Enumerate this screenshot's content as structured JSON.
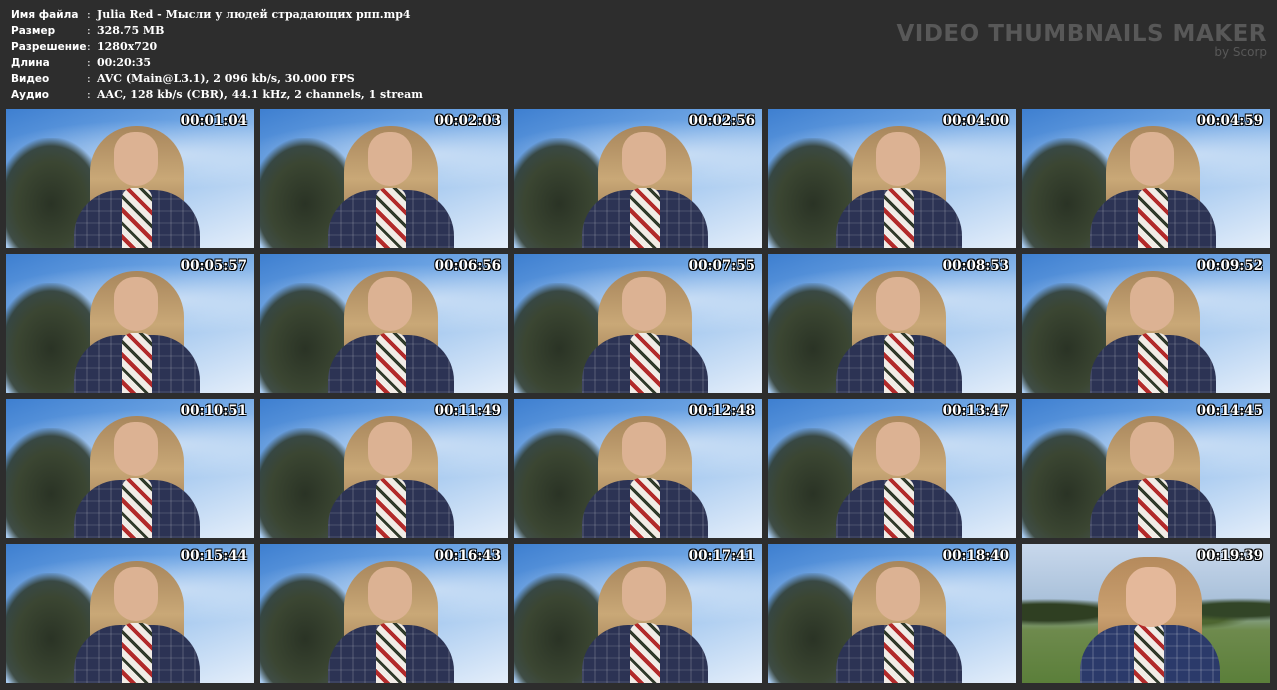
{
  "file_info": [
    {
      "label": "Имя файла",
      "sep": ":",
      "value": "Julia Red - Мысли у людей страдающих рпп.mp4"
    },
    {
      "label": "Размер",
      "sep": ":",
      "value": "328.75 MB"
    },
    {
      "label": "Разрешение",
      "sep": ":",
      "value": "1280x720"
    },
    {
      "label": "Длина",
      "sep": ":",
      "value": "00:20:35"
    },
    {
      "label": "Видео",
      "sep": ":",
      "value": "AVC (Main@L3.1), 2 096 kb/s, 30.000 FPS"
    },
    {
      "label": "Аудио",
      "sep": ":",
      "value": "AAC, 128 kb/s (CBR), 44.1 kHz, 2 channels, 1 stream"
    }
  ],
  "branding": {
    "title": "VIDEO THUMBNAILS MAKER",
    "subtitle": "by Scorp"
  },
  "thumbnails": [
    {
      "timestamp": "00:01:04"
    },
    {
      "timestamp": "00:02:03"
    },
    {
      "timestamp": "00:02:56"
    },
    {
      "timestamp": "00:04:00"
    },
    {
      "timestamp": "00:04:59"
    },
    {
      "timestamp": "00:05:57"
    },
    {
      "timestamp": "00:06:56"
    },
    {
      "timestamp": "00:07:55"
    },
    {
      "timestamp": "00:08:53"
    },
    {
      "timestamp": "00:09:52"
    },
    {
      "timestamp": "00:10:51"
    },
    {
      "timestamp": "00:11:49"
    },
    {
      "timestamp": "00:12:48"
    },
    {
      "timestamp": "00:13:47"
    },
    {
      "timestamp": "00:14:45"
    },
    {
      "timestamp": "00:15:44"
    },
    {
      "timestamp": "00:16:43"
    },
    {
      "timestamp": "00:17:41"
    },
    {
      "timestamp": "00:18:40"
    },
    {
      "timestamp": "00:19:39"
    }
  ],
  "colors": {
    "background": "#2d2d2d",
    "text": "#ffffff",
    "brand": "#585858",
    "sky": "#6ea5e4"
  }
}
